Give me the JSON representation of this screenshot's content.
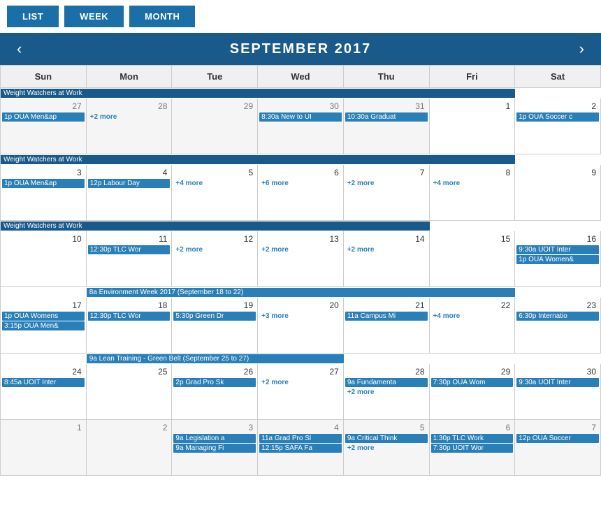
{
  "nav": {
    "buttons": [
      "LIST",
      "WEEK",
      "MONTH"
    ]
  },
  "header": {
    "title": "SEPTEMBER 2017",
    "prev_label": "‹",
    "next_label": "›"
  },
  "day_headers": [
    "Sun",
    "Mon",
    "Tue",
    "Wed",
    "Thu",
    "Fri",
    "Sat"
  ],
  "weeks": [
    {
      "days": [
        {
          "num": "27",
          "other": true,
          "events": []
        },
        {
          "num": "28",
          "other": true,
          "events": []
        },
        {
          "num": "29",
          "other": true,
          "events": []
        },
        {
          "num": "30",
          "other": true,
          "events": []
        },
        {
          "num": "31",
          "other": true,
          "events": []
        },
        {
          "num": "1",
          "other": false,
          "events": []
        },
        {
          "num": "2",
          "other": false,
          "events": []
        }
      ],
      "spanning": [
        {
          "label": "Weight Watchers at Work",
          "col_start": 1,
          "col_span": 6,
          "dark": true
        }
      ],
      "cell_events": {
        "0": [
          {
            "label": "1p OUA Men&ap"
          }
        ],
        "3": [
          {
            "label": "8:30a New to UI"
          }
        ],
        "4": [
          {
            "label": "10:30a Graduat"
          }
        ],
        "5": [],
        "6": [
          {
            "label": "1p OUA Soccer c"
          }
        ],
        "1": [
          {
            "label": "+2 more",
            "more": true
          }
        ]
      }
    },
    {
      "days": [
        {
          "num": "3",
          "other": false,
          "events": []
        },
        {
          "num": "4",
          "other": false,
          "events": []
        },
        {
          "num": "5",
          "other": false,
          "events": []
        },
        {
          "num": "6",
          "other": false,
          "events": []
        },
        {
          "num": "7",
          "other": false,
          "events": []
        },
        {
          "num": "8",
          "other": false,
          "events": []
        },
        {
          "num": "9",
          "other": false,
          "events": []
        }
      ],
      "spanning": [
        {
          "label": "Weight Watchers at Work",
          "col_start": 1,
          "col_span": 6,
          "dark": true
        }
      ],
      "cell_events": {
        "0": [
          {
            "label": "1p OUA Men&ap"
          }
        ],
        "1": [
          {
            "label": "12p Labour Day"
          }
        ],
        "2": [
          {
            "label": "+4 more",
            "more": true
          }
        ],
        "3": [
          {
            "label": "+6 more",
            "more": true
          }
        ],
        "4": [
          {
            "label": "+2 more",
            "more": true
          }
        ],
        "5": [
          {
            "label": "+4 more",
            "more": true
          }
        ]
      }
    },
    {
      "days": [
        {
          "num": "10",
          "other": false,
          "events": []
        },
        {
          "num": "11",
          "other": false,
          "events": []
        },
        {
          "num": "12",
          "other": false,
          "events": []
        },
        {
          "num": "13",
          "other": false,
          "events": []
        },
        {
          "num": "14",
          "other": false,
          "events": []
        },
        {
          "num": "15",
          "other": false,
          "events": []
        },
        {
          "num": "16",
          "other": false,
          "events": []
        }
      ],
      "spanning": [
        {
          "label": "Weight Watchers at Work",
          "col_start": 1,
          "col_span": 5,
          "dark": true
        }
      ],
      "cell_events": {
        "1": [
          {
            "label": "12:30p TLC Wor"
          }
        ],
        "2": [
          {
            "label": "+2 more",
            "more": true
          }
        ],
        "3": [
          {
            "label": "+2 more",
            "more": true
          }
        ],
        "4": [
          {
            "label": "+2 more",
            "more": true
          }
        ],
        "6": [
          {
            "label": "9:30a UOIT Inter"
          },
          {
            "label": "1p OUA Women&"
          }
        ]
      }
    },
    {
      "days": [
        {
          "num": "17",
          "other": false,
          "events": []
        },
        {
          "num": "18",
          "other": false,
          "events": []
        },
        {
          "num": "19",
          "other": false,
          "events": []
        },
        {
          "num": "20",
          "other": false,
          "events": []
        },
        {
          "num": "21",
          "other": false,
          "events": []
        },
        {
          "num": "22",
          "other": false,
          "events": []
        },
        {
          "num": "23",
          "other": false,
          "events": []
        }
      ],
      "spanning": [
        {
          "label": "8a Environment Week 2017 (September 18 to 22)",
          "col_start": 2,
          "col_span": 5,
          "dark": false
        }
      ],
      "cell_events": {
        "0": [
          {
            "label": "1p OUA Womens"
          },
          {
            "label": "3:15p OUA Men&"
          }
        ],
        "1": [
          {
            "label": "12:30p TLC Wor"
          }
        ],
        "2": [
          {
            "label": "5:30p Green Dr"
          }
        ],
        "3": [
          {
            "label": "+3 more",
            "more": true
          }
        ],
        "4": [
          {
            "label": "11a Campus Mi"
          }
        ],
        "5": [
          {
            "label": "+4 more",
            "more": true
          }
        ],
        "6": [
          {
            "label": "6:30p Internatio"
          }
        ]
      }
    },
    {
      "days": [
        {
          "num": "24",
          "other": false,
          "events": []
        },
        {
          "num": "25",
          "other": false,
          "events": []
        },
        {
          "num": "26",
          "other": false,
          "events": []
        },
        {
          "num": "27",
          "other": false,
          "events": []
        },
        {
          "num": "28",
          "other": false,
          "events": []
        },
        {
          "num": "29",
          "other": false,
          "events": []
        },
        {
          "num": "30",
          "other": false,
          "events": []
        }
      ],
      "spanning": [
        {
          "label": "9a Lean Training - Green Belt (September 25 to 27)",
          "col_start": 2,
          "col_span": 3,
          "dark": false
        }
      ],
      "cell_events": {
        "0": [
          {
            "label": "8:45a UOIT Inter"
          }
        ],
        "2": [
          {
            "label": "2p Grad Pro Sk"
          }
        ],
        "3": [
          {
            "label": "+2 more",
            "more": true
          }
        ],
        "4": [
          {
            "label": "9a Fundamenta"
          },
          {
            "label": "+2 more",
            "more": true
          }
        ],
        "5": [
          {
            "label": "7:30p OUA Wom"
          }
        ],
        "6": [
          {
            "label": "9:30a UOIT Inter"
          }
        ]
      }
    },
    {
      "days": [
        {
          "num": "1",
          "other": true,
          "events": []
        },
        {
          "num": "2",
          "other": true,
          "events": []
        },
        {
          "num": "3",
          "other": true,
          "events": []
        },
        {
          "num": "4",
          "other": true,
          "events": []
        },
        {
          "num": "5",
          "other": true,
          "events": []
        },
        {
          "num": "6",
          "other": true,
          "events": []
        },
        {
          "num": "7",
          "other": true,
          "events": []
        }
      ],
      "spanning": [],
      "cell_events": {
        "2": [
          {
            "label": "9a Legislation a"
          },
          {
            "label": "9a Managing Fi"
          }
        ],
        "3": [
          {
            "label": "11a Grad Pro Sl"
          },
          {
            "label": "12:15p SAFA Fa"
          }
        ],
        "4": [
          {
            "label": "9a Critical Think"
          },
          {
            "label": "+2 more",
            "more": true
          }
        ],
        "5": [
          {
            "label": "1:30p TLC Work"
          },
          {
            "label": "7:30p UOIT Wor"
          }
        ],
        "6": [
          {
            "label": "12p OUA Soccer"
          }
        ]
      }
    }
  ]
}
